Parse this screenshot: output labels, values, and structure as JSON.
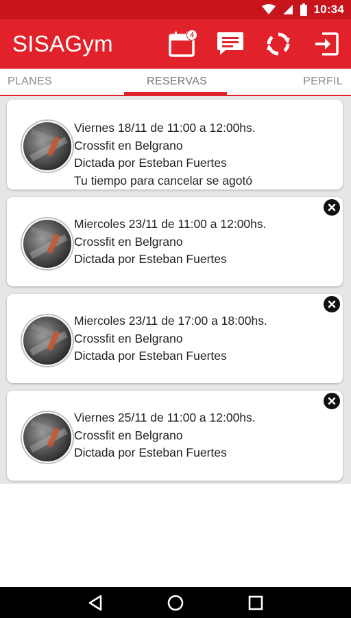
{
  "status_bar": {
    "time": "10:34"
  },
  "app_bar": {
    "title": "SISAGym",
    "calendar_badge": "4",
    "icons": [
      "calendar-icon",
      "message-icon",
      "refresh-icon",
      "exit-icon"
    ]
  },
  "tabs": [
    {
      "label": "PLANES",
      "selected": false
    },
    {
      "label": "RESERVAS",
      "selected": true
    },
    {
      "label": "PERFIL",
      "selected": false
    }
  ],
  "reservations": [
    {
      "line1": "Viernes 18/11 de 11:00 a 12:00hs.",
      "line2": "Crossfit en Belgrano",
      "line3": "Dictada por Esteban Fuertes",
      "line4": "Tu tiempo para cancelar se agotó",
      "cancelable": false
    },
    {
      "line1": "Miercoles 23/11 de 11:00 a 12:00hs.",
      "line2": "Crossfit en Belgrano",
      "line3": "Dictada por Esteban Fuertes",
      "cancelable": true
    },
    {
      "line1": "Miercoles 23/11 de 17:00 a 18:00hs.",
      "line2": "Crossfit en Belgrano",
      "line3": "Dictada por Esteban Fuertes",
      "cancelable": true
    },
    {
      "line1": "Viernes 25/11 de 11:00 a 12:00hs.",
      "line2": "Crossfit en Belgrano",
      "line3": "Dictada por Esteban Fuertes",
      "cancelable": true
    }
  ],
  "colors": {
    "primary": "#e2222a",
    "status_bar": "#c8141c",
    "list_background": "#e6e6e6"
  }
}
